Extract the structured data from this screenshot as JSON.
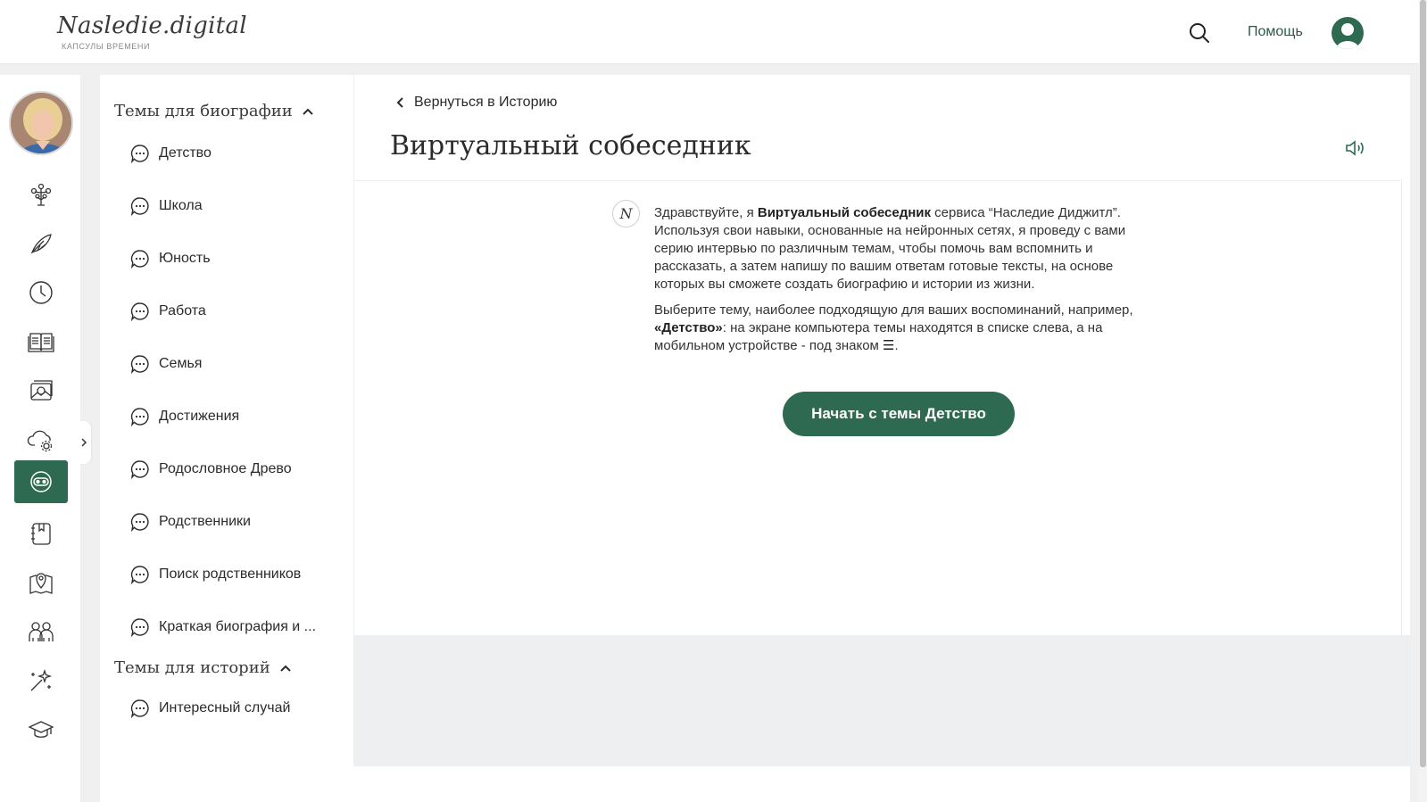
{
  "header": {
    "logo_text": "Nasledie.digital",
    "logo_subtitle": "КАПСУЛЫ ВРЕМЕНИ",
    "help_label": "Помощь",
    "search_icon": "search-icon",
    "avatar_icon": "user-avatar-icon"
  },
  "rail": {
    "items": [
      {
        "icon": "family-tree-icon"
      },
      {
        "icon": "feather-pen-icon"
      },
      {
        "icon": "clock-icon"
      },
      {
        "icon": "open-book-icon"
      },
      {
        "icon": "photo-album-icon"
      },
      {
        "icon": "cloud-settings-icon"
      },
      {
        "icon": "chatbot-icon",
        "active": true
      },
      {
        "icon": "notebook-icon"
      },
      {
        "icon": "map-pin-icon"
      },
      {
        "icon": "people-icon"
      },
      {
        "icon": "magic-wand-icon"
      },
      {
        "icon": "graduation-cap-icon"
      }
    ]
  },
  "topics": {
    "biography_heading": "Темы для биографии",
    "biography_items": [
      "Детство",
      "Школа",
      "Юность",
      "Работа",
      "Семья",
      "Достижения",
      "Родословное Древо",
      "Родственники",
      "Поиск родственников",
      "Краткая биография и ..."
    ],
    "stories_heading": "Темы для историй",
    "stories_items": [
      "Интересный случай"
    ]
  },
  "main": {
    "back_label": "Вернуться в Историю",
    "title": "Виртуальный собеседник",
    "bot_avatar_letter": "N",
    "message_p1_a": "Здравствуйте, я ",
    "message_p1_bold": "Виртуальный собеседник",
    "message_p1_b": " сервиса “Наследие Диджитл”. Используя свои навыки, основанные на нейронных сетях, я проведу с вами серию интервью по различным темам, чтобы помочь вам вспомнить и рассказать, а затем напишу по вашим ответам готовые тексты, на основе которых вы сможете создать биографию и истории из жизни.",
    "message_p2_a": "Выберите тему, наиболее подходящую для ваших воспоминаний, например, ",
    "message_p2_bold": "«Детство»",
    "message_p2_b": ": на экране компьютера темы находятся в списке слева, а на мобильном устройстве - под знаком ",
    "message_p2_symbol": "☰",
    "message_p2_end": ".",
    "start_button_label": "Начать с темы Детство"
  },
  "colors": {
    "accent": "#2e6a52",
    "page_bg": "#f0f0f1",
    "panel_bg": "#ffffff",
    "gray_block": "#eeeff1"
  }
}
